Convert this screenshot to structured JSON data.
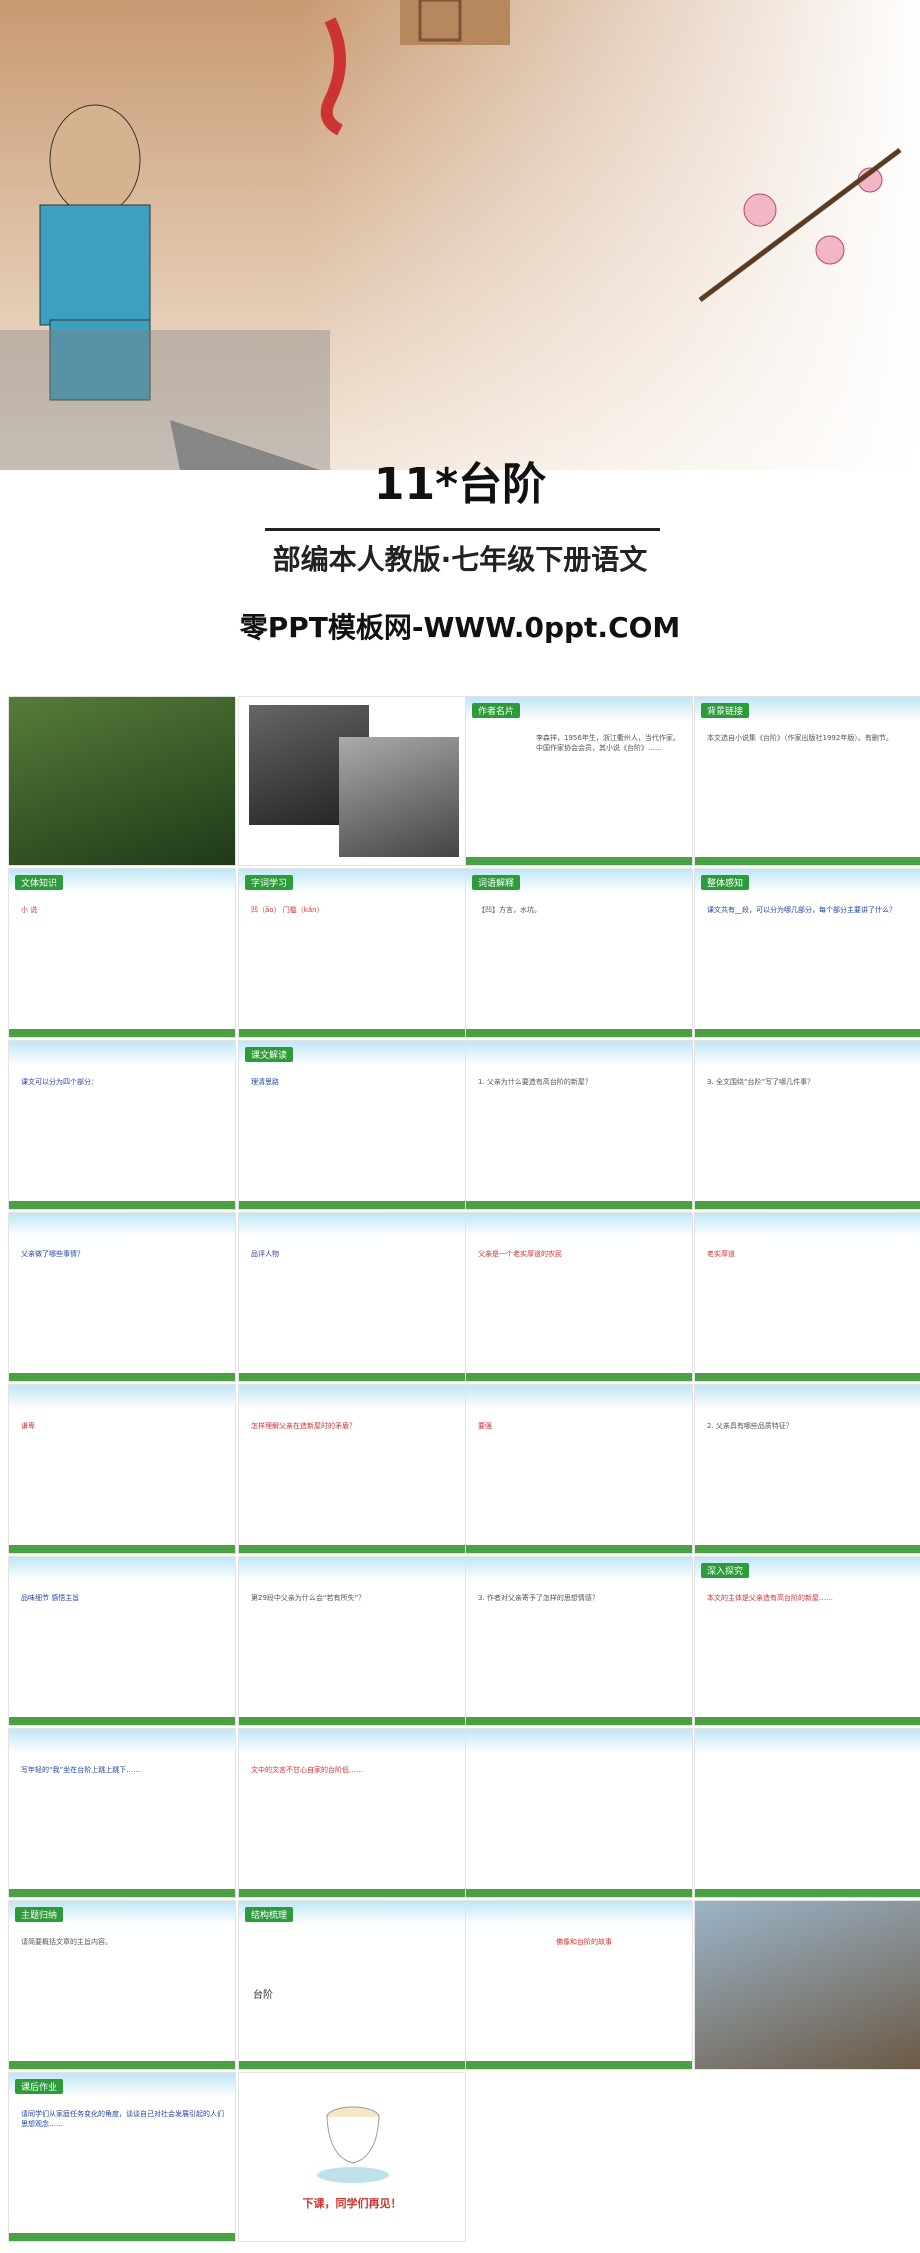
{
  "cover": {
    "title": "11*台阶",
    "subtitle": "部编本人教版·七年级下册语文",
    "website": "零PPT模板网-WWW.0ppt.COM"
  },
  "slides": [
    {
      "tag": "",
      "text": ""
    },
    {
      "tag": "",
      "text": ""
    },
    {
      "tag": "作者名片",
      "text": "李森祥，1956年生，浙江衢州人，当代作家。中国作家协会会员，其小说《台阶》……"
    },
    {
      "tag": "背景链接",
      "text": "本文选自小说集《台阶》（作家出版社1992年版）。有删节。"
    },
    {
      "tag": "文体知识",
      "text": "小 说"
    },
    {
      "tag": "字词学习",
      "text": "凹（āo）  门槛（kǎn）"
    },
    {
      "tag": "词语解释",
      "text": "【凹】方言，水坑。"
    },
    {
      "tag": "整体感知",
      "text": "课文共有__段，可以分为哪几部分，每个部分主要讲了什么？"
    },
    {
      "tag": "",
      "text": "课文可以分为四个部分："
    },
    {
      "tag": "课文解读",
      "text": "理清思路"
    },
    {
      "tag": "",
      "text": "1. 父亲为什么要造有高台阶的新屋？"
    },
    {
      "tag": "",
      "text": "3. 全文围绕“台阶”写了哪几件事？"
    },
    {
      "tag": "",
      "text": "父亲做了哪些事情？"
    },
    {
      "tag": "",
      "text": "品评人物"
    },
    {
      "tag": "",
      "text": "父亲是一个老实厚道的农民"
    },
    {
      "tag": "",
      "text": "老实厚道"
    },
    {
      "tag": "",
      "text": "谦卑"
    },
    {
      "tag": "",
      "text": "怎样理解父亲在造新屋时的矛盾？"
    },
    {
      "tag": "",
      "text": "要强"
    },
    {
      "tag": "",
      "text": "2. 父亲具有哪些品质特征？"
    },
    {
      "tag": "",
      "text": "品味细节 感悟主旨"
    },
    {
      "tag": "",
      "text": "第29段中父亲为什么会“若有所失”？"
    },
    {
      "tag": "",
      "text": "3. 作者对父亲寄予了怎样的思想情感？"
    },
    {
      "tag": "深入探究",
      "text": "本文的主体是父亲造有高台阶的新屋……"
    },
    {
      "tag": "",
      "text": "写年轻的“我”坐在台阶上跳上跳下……"
    },
    {
      "tag": "",
      "text": "文中的文言不甘心自家的台阶低……"
    },
    {
      "tag": "",
      "text": ""
    },
    {
      "tag": "",
      "text": ""
    },
    {
      "tag": "主题归纳",
      "text": "请简要概括文章的主旨内容。"
    },
    {
      "tag": "结构梳理",
      "text": "台阶"
    },
    {
      "tag": "",
      "text": "佛像和台阶的故事"
    },
    {
      "tag": "",
      "text": ""
    },
    {
      "tag": "课后作业",
      "text": "请同学们从家庭任务变化的角度，谈谈自己对社会发展引起的人们思想观念……"
    },
    {
      "tag": "",
      "text": "下课，同学们再见！"
    }
  ]
}
